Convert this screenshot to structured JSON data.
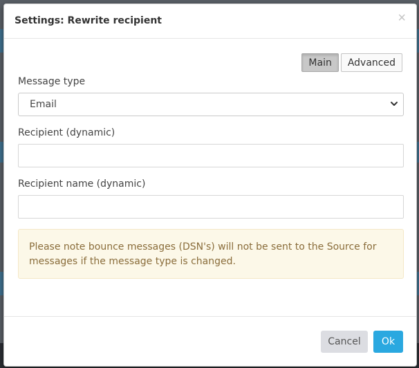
{
  "dialog": {
    "title": "Settings: Rewrite recipient",
    "close_glyph": "×"
  },
  "tabs": [
    {
      "label": "Main",
      "active": true
    },
    {
      "label": "Advanced",
      "active": false
    }
  ],
  "form": {
    "message_type": {
      "label": "Message type",
      "value": "Email"
    },
    "recipient": {
      "label": "Recipient (dynamic)",
      "value": ""
    },
    "recipient_name": {
      "label": "Recipient name (dynamic)",
      "value": ""
    }
  },
  "notice": {
    "text": "Please note bounce messages (DSN's) will not be sent to the Source for messages if the message type is changed."
  },
  "footer": {
    "cancel_label": "Cancel",
    "ok_label": "Ok"
  },
  "colors": {
    "primary": "#2aa8e0",
    "warning_bg": "#fcf8e8",
    "warning_text": "#8a6d3b"
  },
  "icons": {
    "close": "close-icon",
    "select": "chevron-down-icon"
  }
}
